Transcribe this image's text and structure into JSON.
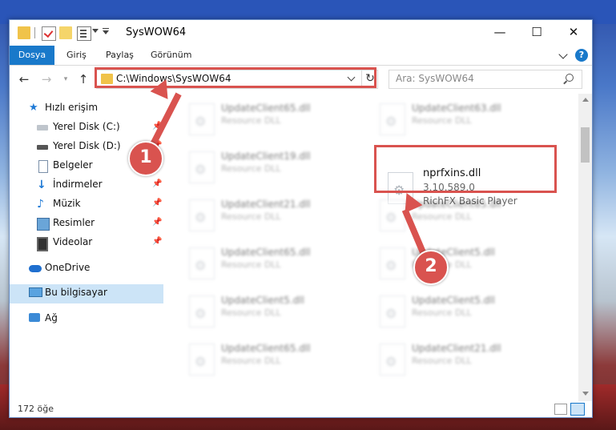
{
  "window": {
    "title": "SysWOW64"
  },
  "ribbon": {
    "tabs": [
      "Dosya",
      "Giriş",
      "Paylaş",
      "Görünüm"
    ],
    "help": "?"
  },
  "nav": {
    "address": "C:\\Windows\\SysWOW64",
    "search_placeholder": "Ara: SysWOW64"
  },
  "sidebar": {
    "quick_access": "Hızlı erişim",
    "items": [
      {
        "label": "Yerel Disk (C:)",
        "icon": "local-disk-c-icon",
        "pinned": true
      },
      {
        "label": "Yerel Disk (D:)",
        "icon": "local-disk-d-icon",
        "pinned": true
      },
      {
        "label": "Belgeler",
        "icon": "documents-icon",
        "pinned": true
      },
      {
        "label": "İndirmeler",
        "icon": "downloads-icon",
        "pinned": true
      },
      {
        "label": "Müzik",
        "icon": "music-icon",
        "pinned": true
      },
      {
        "label": "Resimler",
        "icon": "pictures-icon",
        "pinned": true
      },
      {
        "label": "Videolar",
        "icon": "videos-icon",
        "pinned": true
      }
    ],
    "onedrive": "OneDrive",
    "this_pc": "Bu bilgisayar",
    "network": "Ağ"
  },
  "files": {
    "left": [
      {
        "name": "UpdateClient65.dll",
        "desc": "Resource DLL"
      },
      {
        "name": "UpdateClient19.dll",
        "desc": "Resource DLL"
      },
      {
        "name": "UpdateClient21.dll",
        "desc": "Resource DLL"
      },
      {
        "name": "UpdateClient65.dll",
        "desc": "Resource DLL"
      },
      {
        "name": "UpdateClient5.dll",
        "desc": "Resource DLL"
      },
      {
        "name": "UpdateClient65.dll",
        "desc": "Resource DLL"
      }
    ],
    "right": [
      {
        "name": "UpdateClient63.dll",
        "desc": "Resource DLL"
      },
      {
        "name": "UpdateClient65.dll",
        "desc": "Resource DLL"
      },
      {
        "name": "UpdateClient5.dll",
        "desc": "Resource DLL"
      },
      {
        "name": "UpdateClient5.dll",
        "desc": "Resource DLL"
      },
      {
        "name": "UpdateClient21.dll",
        "desc": "Resource DLL"
      }
    ],
    "focus": {
      "name": "nprfxins.dll",
      "version": "3.10.589.0",
      "desc": "RichFX Basic Player"
    }
  },
  "status": {
    "count": "172 öğe"
  },
  "callouts": [
    "1",
    "2"
  ],
  "colors": {
    "accent": "#1979ca",
    "highlight": "#d9534f",
    "selected": "#cce4f7"
  }
}
